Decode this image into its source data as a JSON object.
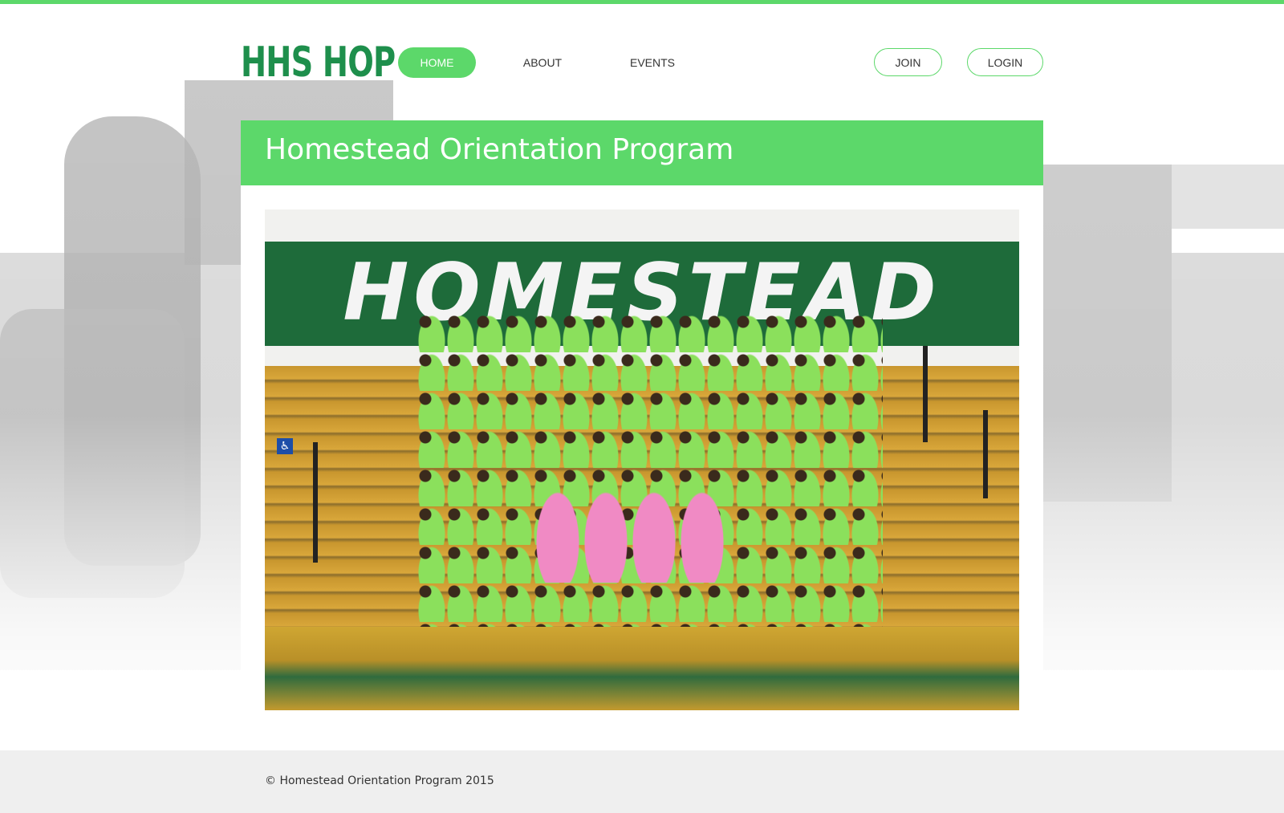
{
  "header": {
    "logo": "HHS HOP",
    "nav": [
      {
        "label": "HOME",
        "active": true
      },
      {
        "label": "ABOUT",
        "active": false
      },
      {
        "label": "EVENTS",
        "active": false
      }
    ],
    "join_label": "JOIN",
    "login_label": "LOGIN"
  },
  "main": {
    "title": "Homestead Orientation Program",
    "photo": {
      "banner_text": "HOMESTEAD"
    }
  },
  "footer": {
    "copyright": "© Homestead Orientation Program 2015"
  },
  "colors": {
    "accent": "#5cd86a",
    "logo": "#1e8f4c",
    "footer_bg": "#efefef"
  }
}
